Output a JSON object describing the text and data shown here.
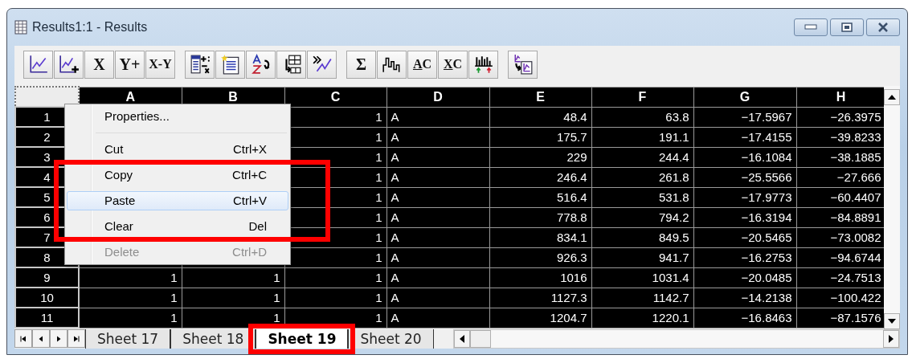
{
  "window": {
    "title": "Results1:1 - Results"
  },
  "toolbar": {
    "groups": [
      [
        {
          "kind": "icon"
        },
        {
          "kind": "icon"
        },
        {
          "kind": "text",
          "label": "X"
        },
        {
          "kind": "text",
          "label": "Y+"
        },
        {
          "kind": "text",
          "label": "X-Y"
        }
      ],
      [
        {
          "kind": "icon"
        },
        {
          "kind": "icon"
        },
        {
          "kind": "icon"
        },
        {
          "kind": "icon"
        },
        {
          "kind": "icon"
        }
      ],
      [
        {
          "kind": "text",
          "label": "Σ"
        },
        {
          "kind": "icon"
        },
        {
          "kind": "underlined",
          "label": "AC"
        },
        {
          "kind": "underlined",
          "label": "XC"
        },
        {
          "kind": "icon"
        }
      ],
      [
        {
          "kind": "icon"
        }
      ]
    ]
  },
  "sheet": {
    "columns": [
      {
        "label": "A",
        "kind": "number"
      },
      {
        "label": "B",
        "kind": "number"
      },
      {
        "label": "C",
        "kind": "number"
      },
      {
        "label": "D",
        "kind": "text"
      },
      {
        "label": "E",
        "kind": "number"
      },
      {
        "label": "F",
        "kind": "number"
      },
      {
        "label": "G",
        "kind": "number"
      },
      {
        "label": "H",
        "kind": "number"
      }
    ],
    "rows": [
      {
        "header": "1",
        "cells": [
          "1",
          "A",
          "48.4",
          "63.8",
          "−17.5967",
          "−26.3975"
        ]
      },
      {
        "header": "2",
        "cells": [
          "1",
          "A",
          "175.7",
          "191.1",
          "−17.4155",
          "−39.8233"
        ]
      },
      {
        "header": "3",
        "cells": [
          "1",
          "A",
          "229",
          "244.4",
          "−16.1084",
          "−38.1885"
        ]
      },
      {
        "header": "4",
        "cells": [
          "1",
          "A",
          "246.4",
          "261.8",
          "−25.5566",
          "−27.666"
        ]
      },
      {
        "header": "5",
        "cells": [
          "1",
          "A",
          "516.4",
          "531.8",
          "−17.9773",
          "−60.4407"
        ]
      },
      {
        "header": "6",
        "cells": [
          "1",
          "A",
          "778.8",
          "794.2",
          "−16.3194",
          "−84.8891"
        ]
      },
      {
        "header": "7",
        "cells": [
          "1",
          "A",
          "834.1",
          "849.5",
          "−20.5465",
          "−73.0082"
        ]
      },
      {
        "header": "8",
        "cells": [
          "1",
          "A",
          "926.3",
          "941.7",
          "−16.2753",
          "−94.6744"
        ]
      },
      {
        "header": "9",
        "cells": [
          "1",
          "1",
          "1",
          "A",
          "1016",
          "1031.4",
          "−20.0485",
          "−24.7513"
        ]
      },
      {
        "header": "10",
        "cells": [
          "1",
          "1",
          "1",
          "A",
          "1127.3",
          "1142.7",
          "−14.2138",
          "−100.422"
        ]
      },
      {
        "header": "11",
        "cells": [
          "1",
          "1",
          "1",
          "A",
          "1204.7",
          "1220.1",
          "−16.8463",
          "−87.1576"
        ]
      }
    ]
  },
  "context_menu": {
    "items": [
      {
        "kind": "item",
        "label": "Properties...",
        "selected": false,
        "disabled": false,
        "boxed": false
      },
      {
        "kind": "separator"
      },
      {
        "kind": "item",
        "label": "Cut",
        "shortcut": "Ctrl+X",
        "selected": false,
        "disabled": false,
        "boxed": false
      },
      {
        "kind": "item",
        "label": "Copy",
        "shortcut": "Ctrl+C",
        "selected": false,
        "disabled": false,
        "boxed": true
      },
      {
        "kind": "item",
        "label": "Paste",
        "shortcut": "Ctrl+V",
        "selected": true,
        "disabled": false,
        "boxed": true
      },
      {
        "kind": "item",
        "label": "Clear",
        "shortcut": "Del",
        "selected": false,
        "disabled": false,
        "boxed": true
      },
      {
        "kind": "item",
        "label": "Delete",
        "shortcut": "Ctrl+D",
        "selected": false,
        "disabled": true,
        "boxed": false
      }
    ]
  },
  "sheet_tabs": [
    {
      "label": "Sheet 17",
      "selected": false,
      "boxed": false
    },
    {
      "label": "Sheet 18",
      "selected": false,
      "boxed": false
    },
    {
      "label": "Sheet 19",
      "selected": true,
      "boxed": true
    },
    {
      "label": "Sheet 20",
      "selected": false,
      "boxed": false
    }
  ]
}
